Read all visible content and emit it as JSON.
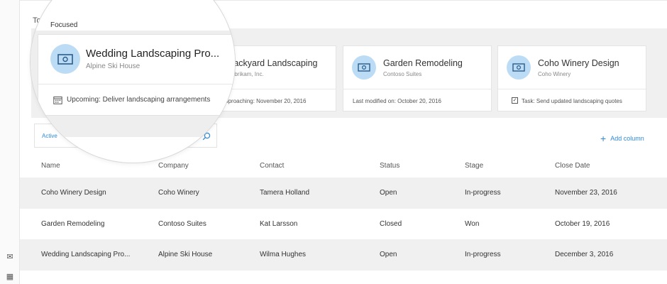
{
  "section_title": "Today",
  "focused_label": "Focused",
  "cards": [
    {
      "title": "Wedding Landscaping Pro...",
      "subtitle": "Alpine Ski House",
      "footer": "Upcoming: Deliver landscaping arrangements",
      "footer_icon": "calendar-icon"
    },
    {
      "title": "Backyard Landscaping",
      "subtitle": "Fabrikam, Inc.",
      "footer": "Due date approaching: November 20, 2016",
      "footer_icon": ""
    },
    {
      "title": "Garden Remodeling",
      "subtitle": "Contoso Suites",
      "footer": "Last modified on: October 20, 2016",
      "footer_icon": ""
    },
    {
      "title": "Coho Winery Design",
      "subtitle": "Coho Winery",
      "footer": "Task: Send updated landscaping quotes",
      "footer_icon": "checkbox-icon"
    }
  ],
  "search": {
    "label": "Active"
  },
  "add_column": "Add column",
  "table": {
    "headers": [
      "Name",
      "Company",
      "Contact",
      "Status",
      "Stage",
      "Close Date"
    ],
    "rows": [
      [
        "Coho Winery Design",
        "Coho Winery",
        "Tamera Holland",
        "Open",
        "In-progress",
        "November 23, 2016"
      ],
      [
        "Garden Remodeling",
        "Contoso Suites",
        "Kat Larsson",
        "Closed",
        "Won",
        "October 19, 2016"
      ],
      [
        "Wedding Landscaping Pro...",
        "Alpine Ski House",
        "Wilma Hughes",
        "Open",
        "In-progress",
        "December 3, 2016"
      ]
    ]
  },
  "colors": {
    "accent": "#2f8ad8",
    "avatar_bg": "#bcdcf5",
    "band_bg": "#f0f0f0"
  }
}
